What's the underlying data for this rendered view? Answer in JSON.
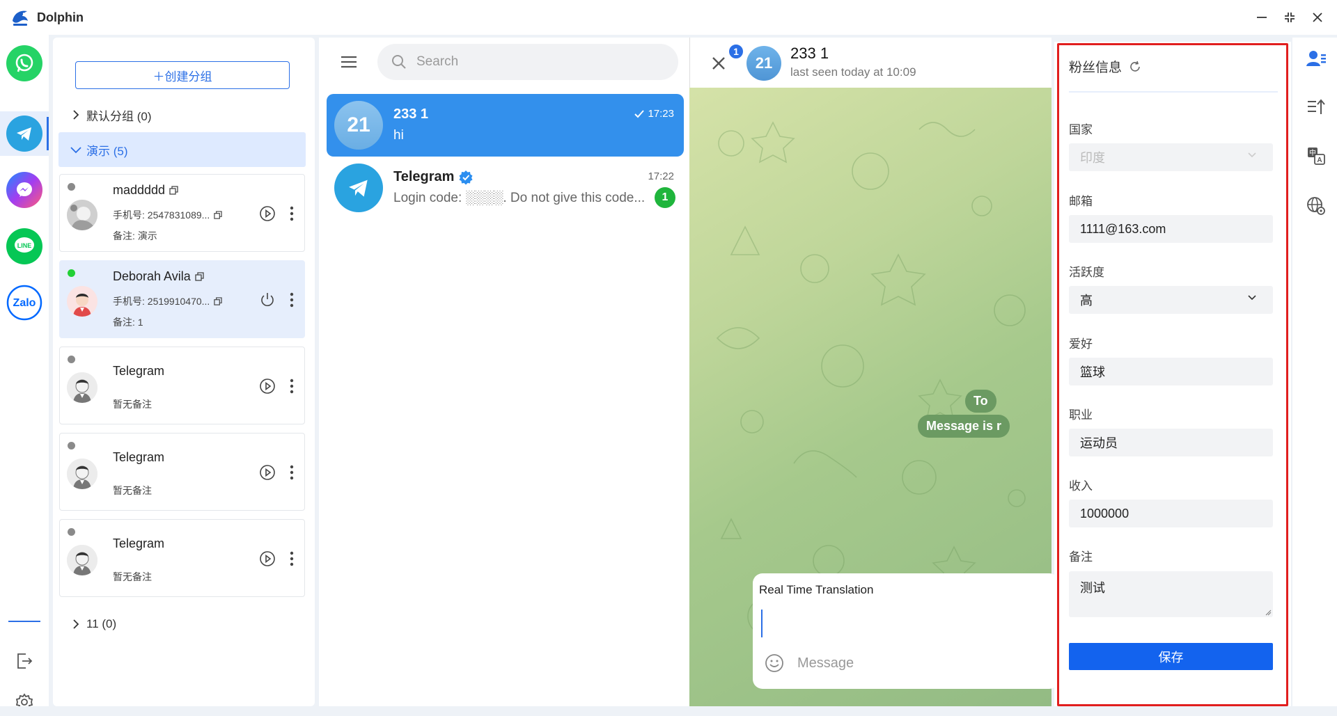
{
  "app": {
    "name": "Dolphin"
  },
  "colors": {
    "accent": "#2b6fe6",
    "telegram_blue": "#3390ec",
    "highlight_frame": "#e11e1e",
    "online": "#22d036",
    "save": "#1363ee"
  },
  "rail": {
    "apps": [
      {
        "name": "WhatsApp",
        "icon": "whatsapp-icon",
        "color": "#25d366"
      },
      {
        "name": "Telegram",
        "icon": "telegram-icon",
        "color": "#2aa3e0",
        "active": true
      },
      {
        "name": "Messenger",
        "icon": "messenger-icon",
        "color": "#a33df0"
      },
      {
        "name": "LINE",
        "icon": "line-icon",
        "color": "#06c755"
      },
      {
        "name": "Zalo",
        "icon": "zalo-icon",
        "color": "#0068ff",
        "label": "Zalo"
      }
    ],
    "line_label": "LINE",
    "zalo_label": "Zalo"
  },
  "groups": {
    "create_label": "＋创建分组",
    "default_group": "默认分组 (0)",
    "demo_group": "演示 (5)",
    "other_group": "11 (0)",
    "accounts": [
      {
        "name": "maddddd",
        "phone": "手机号: 2547831089...",
        "note": "备注: 演示",
        "online": false,
        "action": "play"
      },
      {
        "name": "Deborah Avila",
        "phone": "手机号: 2519910470...",
        "note": "备注: 1",
        "online": true,
        "action": "power"
      },
      {
        "name": "Telegram",
        "note": "暂无备注",
        "online": false,
        "action": "play"
      },
      {
        "name": "Telegram",
        "note": "暂无备注",
        "online": false,
        "action": "play"
      },
      {
        "name": "Telegram",
        "note": "暂无备注",
        "online": false,
        "action": "play"
      }
    ]
  },
  "chats": {
    "search_placeholder": "Search",
    "items": [
      {
        "avatar_text": "21",
        "title": "233 1",
        "time": "17:23",
        "preview": "hi",
        "read": true
      },
      {
        "title": "Telegram",
        "time": "17:22",
        "preview": "Login code: ░░░░. Do not give this code...",
        "unread": "1",
        "verified": true
      }
    ]
  },
  "conversation": {
    "badge": "1",
    "avatar_text": "21",
    "name": "233 1",
    "status": "last seen today at 10:09",
    "pills": [
      "To",
      "Message is r"
    ],
    "translation_label": "Real Time Translation",
    "message_placeholder": "Message"
  },
  "fan_info": {
    "title": "粉丝信息",
    "fields": {
      "country": {
        "label": "国家",
        "value": "印度"
      },
      "email": {
        "label": "邮箱",
        "value": "1111@163.com"
      },
      "activity": {
        "label": "活跃度",
        "value": "高"
      },
      "hobby": {
        "label": "爱好",
        "value": "篮球"
      },
      "job": {
        "label": "职业",
        "value": "运动员"
      },
      "income": {
        "label": "收入",
        "value": "1000000"
      },
      "remark": {
        "label": "备注",
        "value": "测试"
      }
    },
    "save_label": "保存"
  },
  "right_rail": {
    "icons": [
      "contact-info-icon",
      "sort-up-icon",
      "translate-icon",
      "globe-settings-icon"
    ]
  }
}
